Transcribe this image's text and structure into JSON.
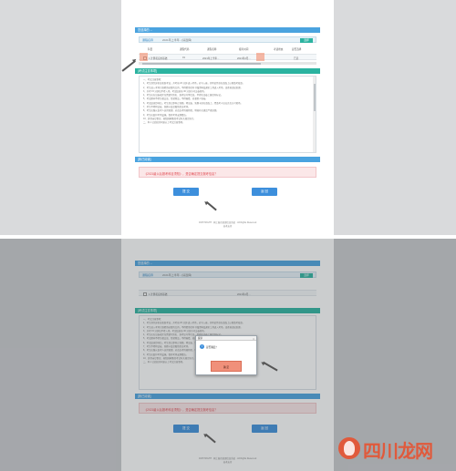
{
  "top": {
    "section_header": "您选择的 ...",
    "search_label": "课程名称",
    "search_value": "2021年上半年...(请选择)",
    "search_button": "选择",
    "table_headers": [
      "科目",
      "课程代码",
      "课程名称",
      "报考时间",
      "考试状态",
      "是否选择"
    ],
    "table_row": [
      "1 计算机应用基础",
      "01",
      "2021年上半年...",
      "2021年4月...",
      "已选"
    ],
    "notice_title": "[考试注意事项]",
    "notice_lines": [
      "一、考试注意事项：",
      "1、考生须凭身份证和准考证，开考前 20 分钟 进入考场，对号入座，并将证件放在桌面上以便监考核查。",
      "2、考生进入考场只准携带必要的文具，不得携带任何书籍资料及通讯工具进入考场，违者按违纪处理。",
      "3、开考 15 分钟后不得入场，考试结束前 30 分钟方可交卷离场。",
      "4、考生应在试卷规定位置填写姓名、准考证号等信息，不得在试卷上做任何标记。",
      "5、考试期间不得互相交谈、传递物品，不得偷看、抄袭他人答卷。",
      "6、考试结束铃响后，考生须立即停止答题，将试卷、答题卡放在桌面上，经监考人员允许后方可离场。",
      "7、考生不得将试卷、答题卡及草稿纸带出考场。",
      "8、考生应服从监考人员的管理，对违反考场规则者，将按有关规定严肃处理。",
      "9、考生应爱护考场设施，保持考场安静整洁。",
      "10、其他未尽事宜，按照国家教育考试有关规定执行。",
      "二、本人已阅读并同意以上考试注意事项。"
    ],
    "agree_bar": "[我已阅读]",
    "warning": "《2021级以后报考科目须知》，是否确定提交报考信息？",
    "submit_label": "提 交",
    "back_label": "返 回",
    "footer_1": "COPYRIGHT · 网上报名管理信息系统 · All Rights Reserved",
    "footer_2": "技术支持"
  },
  "dialog": {
    "title": "提示",
    "close": "×",
    "icon": "i",
    "message": "是否确定？",
    "ok_label": "确 定"
  },
  "watermark": {
    "text": "四川龙网"
  },
  "colors": {
    "accent_blue": "#4aa3df",
    "accent_green": "#2bb3a0",
    "warning_red": "#e0474f",
    "highlight_orange": "#f48360"
  }
}
